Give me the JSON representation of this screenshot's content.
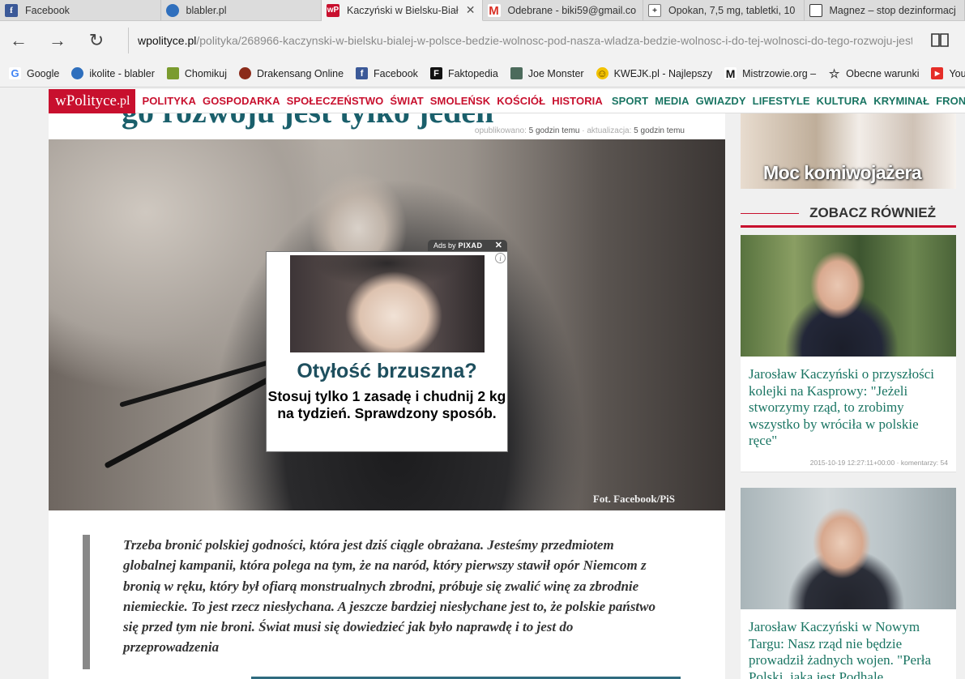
{
  "browser": {
    "tabs": [
      {
        "label": "Facebook",
        "icon": "facebook-icon",
        "fav_text": "f",
        "active": false
      },
      {
        "label": "blabler.pl",
        "icon": "globe-icon",
        "fav_text": "",
        "active": false
      },
      {
        "label": "Kaczyński w Bielsku-Biał",
        "icon": "wpolityce-icon",
        "fav_text": "wP",
        "active": true
      },
      {
        "label": "Odebrane - biki59@gmail.co",
        "icon": "gmail-icon",
        "fav_text": "M",
        "active": false
      },
      {
        "label": "Opokan, 7,5 mg, tabletki, 10",
        "icon": "plus-icon",
        "fav_text": "+",
        "active": false
      },
      {
        "label": "Magnez – stop dezinformacj",
        "icon": "window-icon",
        "fav_text": "",
        "active": false
      }
    ],
    "address": {
      "host": "wpolityce.pl",
      "path": "/polityka/268966-kaczynski-w-bielsku-bialej-w-polsce-bedzie-wolnosc-pod-nasza-wladza-bedzie-wolnosc-i-do-tej-wolnosci-do-tego-rozwoju-jest-tylko-jede"
    },
    "bookmarks": [
      {
        "label": "Google",
        "icon": "google-icon",
        "fav_text": "G",
        "color": "#4285f4"
      },
      {
        "label": "ikolite - blabler",
        "icon": "globe-icon",
        "fav_text": "",
        "color": "#2f6fbd"
      },
      {
        "label": "Chomikuj",
        "icon": "chomikuj-icon",
        "fav_text": "",
        "color": "#7a9b2e"
      },
      {
        "label": "Drakensang Online",
        "icon": "drakensang-icon",
        "fav_text": "",
        "color": "#8b2b1a"
      },
      {
        "label": "Facebook",
        "icon": "facebook-icon",
        "fav_text": "f",
        "color": "#3b5998"
      },
      {
        "label": "Faktopedia",
        "icon": "faktopedia-icon",
        "fav_text": "F",
        "color": "#111111"
      },
      {
        "label": "Joe Monster",
        "icon": "joe-monster-icon",
        "fav_text": "",
        "color": "#4c6b5c"
      },
      {
        "label": "KWEJK.pl - Najlepszy",
        "icon": "smiley-icon",
        "fav_text": "☺",
        "color": "#f2c200"
      },
      {
        "label": "Mistrzowie.org –",
        "icon": "mistrzowie-icon",
        "fav_text": "M",
        "color": "#ffffff"
      },
      {
        "label": "Obecne warunki",
        "icon": "star-icon",
        "fav_text": "☆",
        "color": "#ffffff"
      },
      {
        "label": "YouT",
        "icon": "youtube-icon",
        "fav_text": "▶",
        "color": "#e52d27"
      }
    ]
  },
  "site": {
    "logo": "wPolityce",
    "logo_suffix": ".pl",
    "nav_red": [
      "POLITYKA",
      "GOSPODARKA",
      "SPOŁECZEŃSTWO",
      "ŚWIAT",
      "SMOLEŃSK",
      "KOŚCIÓŁ",
      "HISTORIA"
    ],
    "nav_green": [
      "SPORT",
      "MEDIA",
      "GWIAZDY",
      "LIFESTYLE",
      "KULTURA",
      "KRYMINAŁ",
      "FRONDA"
    ],
    "colors": {
      "brand_red": "#c8102e",
      "brand_green": "#1a7563"
    }
  },
  "article": {
    "headline_fragment": "go rozwoju jest tylko jeden",
    "published_label": "opublikowano:",
    "published_value": "5 godzin temu",
    "updated_label": "· aktualizacja:",
    "updated_value": "5 godzin temu",
    "photo_caption": "Fot. Facebook/PiS",
    "lead": "Trzeba bronić polskiej godności, która jest dziś ciągle obrażana. Jesteśmy przedmiotem globalnej kampanii, która polega na tym, że na naród, który pierwszy stawił opór Niemcom z bronią w ręku, który był ofiarą monstrualnych zbrodni, próbuje się zwalić winę za zbrodnie niemieckie. To jest rzecz niesłychana. A jeszcze bardziej niesłychane jest to, że polskie państwo się przed tym nie broni. Świat musi się dowiedzieć jak było naprawdę i to jest do przeprowadzenia"
  },
  "ad": {
    "label_prefix": "Ads by",
    "label_brand": "PIXAD",
    "title": "Otyłość brzuszna?",
    "body": "Stosuj tylko 1 zasadę i chudnij 2 kg na tydzień. Sprawdzony sposób."
  },
  "sidebar": {
    "promo_title": "Moc komiwojażera",
    "section_title": "ZOBACZ RÓWNIEŻ",
    "cards": [
      {
        "title": "Jarosław Kaczyński o przyszłości kolejki na Kasprowy: \"Jeżeli stworzymy rząd, to zrobimy wszystko by wróciła w polskie ręce\"",
        "date": "2015-10-19 12:27:11+00:00",
        "comments_label": "· komentarzy:",
        "comments": "54"
      },
      {
        "title": "Jarosław Kaczyński w Nowym Targu: Nasz rząd nie będzie prowadził żadnych wojen. \"Perła Polski, jaką jest Podhale",
        "date": "",
        "comments_label": "",
        "comments": ""
      }
    ]
  }
}
